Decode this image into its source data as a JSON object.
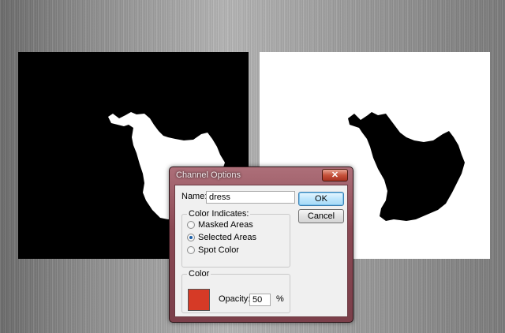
{
  "dialog": {
    "title": "Channel Options",
    "close_label": "✕",
    "name_label": "Name:",
    "name_value": "dress",
    "ok_label": "OK",
    "cancel_label": "Cancel",
    "color_indicates": {
      "title": "Color Indicates:",
      "options": [
        "Masked Areas",
        "Selected Areas",
        "Spot Color"
      ],
      "selected": "Selected Areas"
    },
    "color_group": {
      "title": "Color",
      "swatch_color": "#d63a26",
      "opacity_label": "Opacity:",
      "opacity_value": "50",
      "opacity_unit": "%"
    }
  },
  "canvases": {
    "left": {
      "background": "#000000",
      "shape_fill": "#ffffff"
    },
    "right": {
      "background": "#ffffff",
      "shape_fill": "#000000"
    }
  }
}
